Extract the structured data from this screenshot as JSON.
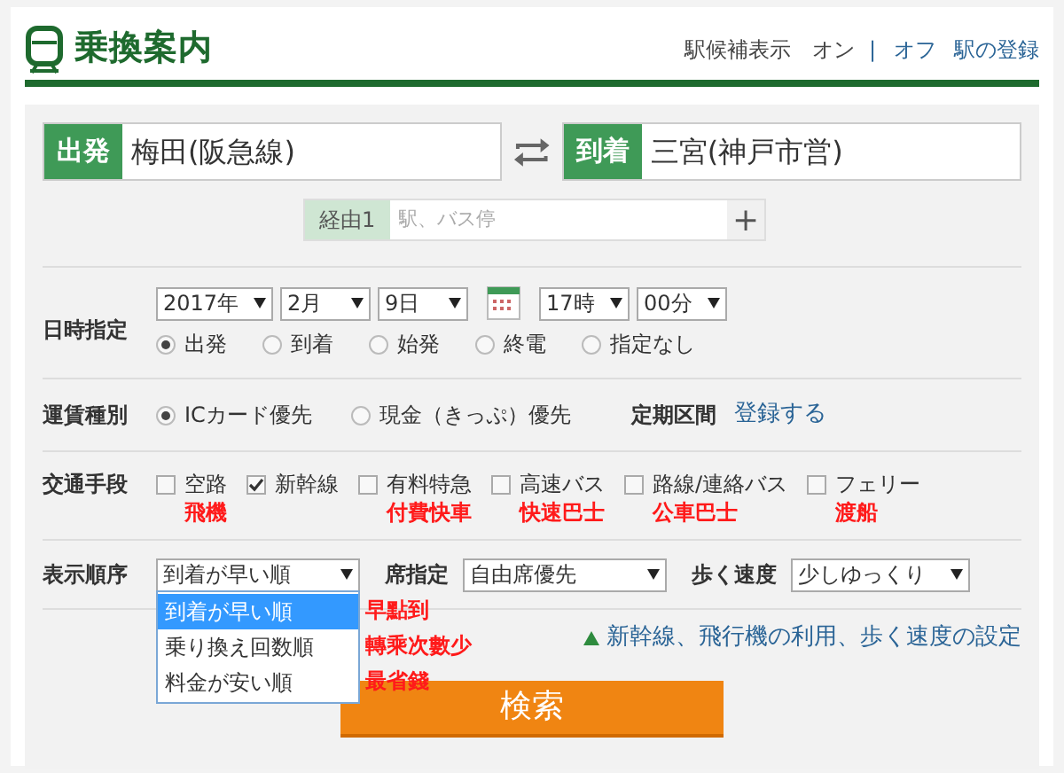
{
  "header": {
    "title": "乗換案内",
    "links": [
      {
        "text": "駅候補表示",
        "kind": "label"
      },
      {
        "text": "オン",
        "kind": "current"
      },
      {
        "text": "|",
        "kind": "sep"
      },
      {
        "text": "オフ",
        "kind": "link"
      },
      {
        "text": "駅の登録",
        "kind": "link"
      }
    ]
  },
  "route": {
    "from": {
      "label": "出発",
      "value": "梅田(阪急線)"
    },
    "to": {
      "label": "到着",
      "value": "三宮(神戸市営)"
    },
    "via": {
      "label": "経由1",
      "placeholder": "駅、バス停",
      "add": "+"
    }
  },
  "datetime": {
    "label": "日時指定",
    "selects": [
      "2017年",
      "2月",
      "9日",
      "17時",
      "00分"
    ],
    "options": [
      {
        "label": "出発",
        "selected": true
      },
      {
        "label": "到着",
        "selected": false
      },
      {
        "label": "始発",
        "selected": false
      },
      {
        "label": "終電",
        "selected": false
      },
      {
        "label": "指定なし",
        "selected": false
      }
    ]
  },
  "fare": {
    "label": "運賃種別",
    "options": [
      {
        "label": "ICカード優先",
        "selected": true
      },
      {
        "label": "現金（きっぷ）優先",
        "selected": false
      }
    ],
    "pass_label": "定期区間",
    "pass_link": "登録する"
  },
  "transport": {
    "label": "交通手段",
    "items": [
      {
        "label": "空路",
        "note": "飛機",
        "checked": false
      },
      {
        "label": "新幹線",
        "checked": true
      },
      {
        "label": "有料特急",
        "note": "付費快車",
        "checked": false
      },
      {
        "label": "高速バス",
        "note": "快速巴士",
        "checked": false
      },
      {
        "label": "路線/連絡バス",
        "note": "公車巴士",
        "checked": false
      },
      {
        "label": "フェリー",
        "note": "渡船",
        "checked": false
      }
    ]
  },
  "sort": {
    "label": "表示順序",
    "value": "到着が早い順",
    "options": [
      {
        "label": "到着が早い順",
        "note": "早點到",
        "selected": true
      },
      {
        "label": "乗り換え回数順",
        "note": "轉乘次數少",
        "selected": false
      },
      {
        "label": "料金が安い順",
        "note": "最省錢",
        "selected": false
      }
    ],
    "seat_label": "席指定",
    "seat_value": "自由席優先",
    "walk_label": "歩く速度",
    "walk_value": "少しゆっくり"
  },
  "settings_link": "新幹線、飛行機の利用、歩く速度の設定",
  "search_button": "検索"
}
